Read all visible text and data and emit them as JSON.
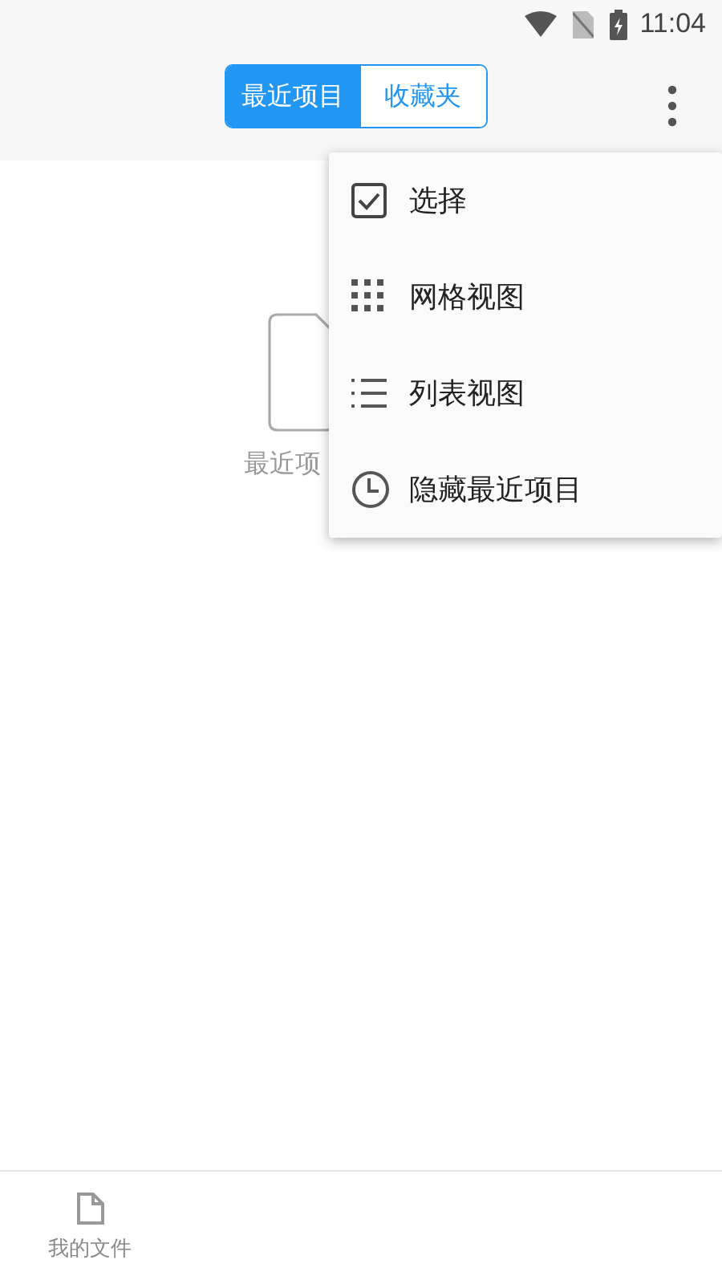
{
  "status_bar": {
    "time": "11:04"
  },
  "tabs": [
    {
      "label": "最近项目",
      "selected": true
    },
    {
      "label": "收藏夹",
      "selected": false
    }
  ],
  "empty_state": {
    "text": "最近项"
  },
  "menu": {
    "items": [
      {
        "kind": "select",
        "label": "选择"
      },
      {
        "kind": "grid",
        "label": "网格视图"
      },
      {
        "kind": "list",
        "label": "列表视图"
      },
      {
        "kind": "clock",
        "label": "隐藏最近项目"
      }
    ]
  },
  "bottom_nav": {
    "items": [
      {
        "label": "我的文件"
      }
    ]
  }
}
